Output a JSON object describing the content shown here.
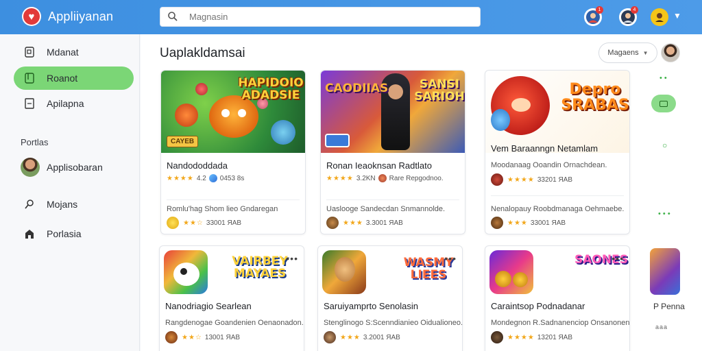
{
  "header": {
    "app_title": "Appliiyanan",
    "search_placeholder": "Magnasin",
    "notif1_count": "1",
    "notif2_count": "4"
  },
  "sidebar": {
    "items": [
      {
        "label": "Mdanat",
        "icon": "document-icon"
      },
      {
        "label": "Roanot",
        "icon": "book-icon",
        "active": true
      },
      {
        "label": "Apilapna",
        "icon": "page-icon"
      }
    ],
    "section_label": "Portlas",
    "items2": [
      {
        "label": "Applisobaran",
        "icon": "avatar"
      },
      {
        "label": "Mojans",
        "icon": "search-icon"
      },
      {
        "label": "Porlasia",
        "icon": "home-icon"
      }
    ]
  },
  "main": {
    "title": "Uaplakldamsai",
    "filter_label": "Magaens"
  },
  "cards": [
    {
      "hero_text": "HAPIDOIO ADADSIE",
      "hero_tag": "CAYEB",
      "name": "Nandododdada",
      "rating_text": "4.2",
      "meta_text": "0453 8s",
      "desc": "Romlu'hag Shom lieo Gndaregan",
      "foot_stars": "★★☆",
      "foot_text": "33001 ЯAB"
    },
    {
      "hero_text_left": "CAODIIAS",
      "hero_text_right": "SANSI SARIOH",
      "hero_tag": "",
      "name": "Ronan Ieaoknsan Radtlato",
      "rating_text": "3.2KN",
      "meta_text": "Rare Repgodnoo.",
      "desc": "Uaslooge Sandecdan Snmannolde.",
      "foot_stars": "★★★",
      "foot_text": "3.3001 ЯAB"
    },
    {
      "hero_text": "Depro SRABAS",
      "hero_tag": "",
      "name": "Vem Baraanngn Netamlam",
      "rating_text": "",
      "meta_text": "Moodanaag Ooandin Ornachdean.",
      "desc_meta_stars": "★★★★",
      "desc_meta_text": "33201 ЯAB",
      "desc": "Nenalopauy Roobdmanaga Oehmaebe.",
      "foot_stars": "★★★",
      "foot_text": "33001 ЯAB"
    },
    {
      "hero_text": "VAIRBEY MAYAES",
      "name": "Nanodriagio Searlean",
      "desc": "Rangdenogae Goandenien Oenaonadon.",
      "foot_stars": "★★☆",
      "foot_text": "13001 ЯAB"
    },
    {
      "hero_text": "WASMY LIEES",
      "name": "Saruiyamprto Senolasin",
      "desc": "Stenglinogo S:Scenndianieo Oidualioneo.",
      "foot_stars": "★★★",
      "foot_text": "3.2001 ЯAB"
    },
    {
      "hero_text": "SAONES",
      "name": "Caraintsop Podnadanar",
      "desc": "Mondegnon R.Sadnanenciop Onsanoneno.",
      "foot_stars": "★★★★",
      "foot_text": "13201 ЯAB"
    }
  ],
  "rail": {
    "peek_label": "P Penna",
    "peek_dots": "ааa"
  },
  "colors": {
    "topbar": "#3d8fe0",
    "active_nav": "#7bd676",
    "star": "#f2a71b",
    "logo": "#e23a3a"
  }
}
